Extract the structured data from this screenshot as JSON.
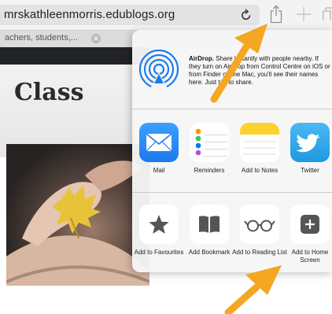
{
  "browser": {
    "url": "mrskathleenmorris.edublogs.org",
    "tab_title": "achers, students,...",
    "toolbar_icons": [
      "reload-icon",
      "share-icon",
      "new-tab-icon",
      "tabs-icon"
    ]
  },
  "page": {
    "heading": "Class"
  },
  "share_sheet": {
    "airdrop": {
      "title": "AirDrop.",
      "description": "Share instantly with people nearby. If they turn on AirDrop from Control Centre on iOS or from Finder on the Mac, you'll see their names here. Just tap to share."
    },
    "apps": [
      {
        "label": "Mail",
        "icon": "mail-icon"
      },
      {
        "label": "Reminders",
        "icon": "reminders-icon"
      },
      {
        "label": "Add to Notes",
        "icon": "notes-icon"
      },
      {
        "label": "Twitter",
        "icon": "twitter-icon"
      }
    ],
    "actions": [
      {
        "label": "Add to Favourites",
        "icon": "star-icon"
      },
      {
        "label": "Add Bookmark",
        "icon": "book-icon"
      },
      {
        "label": "Add to Reading List",
        "icon": "glasses-icon"
      },
      {
        "label": "Add to Home Screen",
        "icon": "plus-square-icon"
      }
    ]
  },
  "colors": {
    "arrow": "#f5a623",
    "mail_blue": "#1d8cf7",
    "twitter_blue": "#29a6ec",
    "notes_yellow": "#fcd230"
  }
}
